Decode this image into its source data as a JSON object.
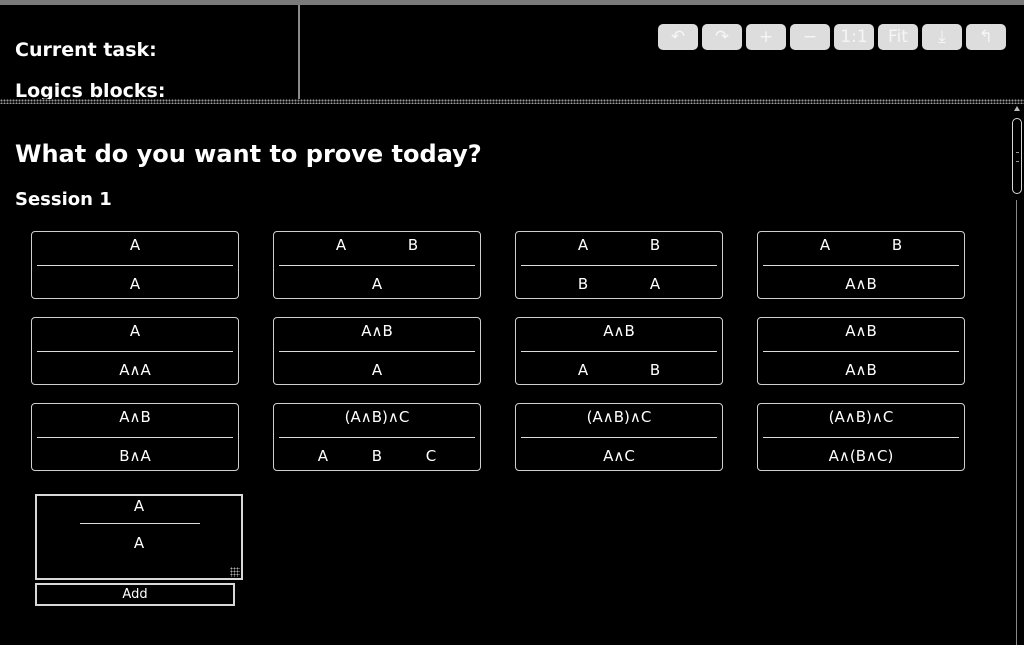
{
  "header": {
    "current_task_label": "Current task:",
    "logic_blocks_label": "Logics blocks:"
  },
  "toolbar": {
    "buttons": [
      {
        "name": "undo",
        "icon": "undo-icon",
        "glyph": "↶"
      },
      {
        "name": "redo",
        "icon": "redo-icon",
        "glyph": "↷"
      },
      {
        "name": "zoom-in",
        "icon": "plus-icon",
        "glyph": "+"
      },
      {
        "name": "zoom-out",
        "icon": "minus-icon",
        "glyph": "−"
      },
      {
        "name": "actual-size",
        "icon": "actual-size-icon",
        "glyph": "1:1"
      },
      {
        "name": "fit",
        "icon": "fit-icon",
        "glyph": "Fit"
      },
      {
        "name": "download",
        "icon": "download-icon",
        "glyph": "⤓"
      },
      {
        "name": "reset",
        "icon": "reset-icon",
        "glyph": "↰"
      }
    ]
  },
  "main": {
    "heading": "What do you want to prove today?",
    "session_title": "Session 1",
    "rules": [
      {
        "premises": [
          "A"
        ],
        "conclusions": [
          "A"
        ]
      },
      {
        "premises": [
          "A",
          "B"
        ],
        "conclusions": [
          "A"
        ]
      },
      {
        "premises": [
          "A",
          "B"
        ],
        "conclusions": [
          "B",
          "A"
        ]
      },
      {
        "premises": [
          "A",
          "B"
        ],
        "conclusions": [
          "A∧B"
        ]
      },
      {
        "premises": [
          "A"
        ],
        "conclusions": [
          "A∧A"
        ]
      },
      {
        "premises": [
          "A∧B"
        ],
        "conclusions": [
          "A"
        ]
      },
      {
        "premises": [
          "A∧B"
        ],
        "conclusions": [
          "A",
          "B"
        ]
      },
      {
        "premises": [
          "A∧B"
        ],
        "conclusions": [
          "A∧B"
        ]
      },
      {
        "premises": [
          "A∧B"
        ],
        "conclusions": [
          "B∧A"
        ]
      },
      {
        "premises": [
          "(A∧B)∧C"
        ],
        "conclusions": [
          "A",
          "B",
          "C"
        ]
      },
      {
        "premises": [
          "(A∧B)∧C"
        ],
        "conclusions": [
          "A∧C"
        ]
      },
      {
        "premises": [
          "(A∧B)∧C"
        ],
        "conclusions": [
          "A∧(B∧C)"
        ]
      }
    ],
    "editor": {
      "premise": "A",
      "conclusion": "A"
    },
    "add_label": "Add"
  },
  "colors": {
    "background": "#000000",
    "text": "#ffffff",
    "card_border": "#cfcfcf",
    "toolbar_button": "#dddddd"
  }
}
